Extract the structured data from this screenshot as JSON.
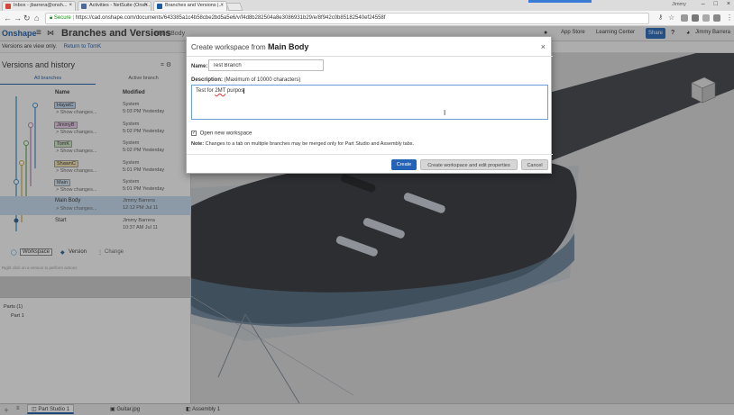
{
  "browser": {
    "tabs": [
      {
        "label": "Inbox - jbarrera@onsh...",
        "color": "#d44638"
      },
      {
        "label": "Activities - NetSuite (Onsh...",
        "color": "#4a6b9a"
      },
      {
        "label": "Branches and Versions |...",
        "color": "#1a5aa6"
      }
    ],
    "user": "Jimmy",
    "url_secure": "Secure",
    "url": "https://cad.onshape.com/documents/643385a1c4b58cbe2bd5a5e6/v/f4d8b282504a8e3086931b29/e/8f942c0b85182540ef24558f"
  },
  "header": {
    "logo": "Onshape",
    "doc_title": "Branches and Versions",
    "doc_sub": "Main Body",
    "app_store": "App Store",
    "learning_center": "Learning Center",
    "share": "Share",
    "help": "?",
    "user": "Jimmy Barrera"
  },
  "viewonly": {
    "text": "Versions are view only.",
    "link": "Return to TomK"
  },
  "panel": {
    "title": "Versions and history",
    "tabs": [
      "All branches",
      "Active branch"
    ],
    "col_name": "Name",
    "col_modified": "Modified",
    "rows": [
      {
        "name": "HayatC",
        "show": "> Show changes...",
        "by": "System",
        "when": "5:03 PM Yesterday",
        "tag": true,
        "tagcolor": "#bcd7ef"
      },
      {
        "name": "JimmyB",
        "show": "> Show changes...",
        "by": "System",
        "when": "5:02 PM Yesterday",
        "tag": true,
        "tagcolor": "#e6c9e6"
      },
      {
        "name": "TomK",
        "show": "> Show changes...",
        "by": "System",
        "when": "5:02 PM Yesterday",
        "tag": true,
        "tagcolor": "#c9e6c0"
      },
      {
        "name": "ShawnC",
        "show": "> Show changes...",
        "by": "System",
        "when": "5:01 PM Yesterday",
        "tag": true,
        "tagcolor": "#f0e0a8"
      },
      {
        "name": "Main",
        "show": "> Show changes...",
        "by": "System",
        "when": "5:01 PM Yesterday",
        "tag": true,
        "tagcolor": "#cfe3f2"
      },
      {
        "name": "Main Body",
        "show": "> Show changes...",
        "by": "Jimmy Barrera",
        "when": "12:12 PM Jul 11",
        "tag": false,
        "tagcolor": ""
      },
      {
        "name": "Start",
        "show": "",
        "by": "Jimmy Barrera",
        "when": "10:37 AM Jul 11",
        "tag": false,
        "tagcolor": ""
      }
    ],
    "legend_workspace": "Workspace",
    "legend_version": "Version",
    "legend_change": "Change",
    "rightclick": "Right click on a version to perform actions",
    "parts_header": "Parts (1)",
    "part_item": "Part 1"
  },
  "bottom_tabs": [
    "Part Studio 1",
    "Guitar.jpg",
    "Assembly 1"
  ],
  "dialog": {
    "title_prefix": "Create workspace from",
    "title_bold": "Main Body",
    "close": "×",
    "name_label": "Name:",
    "name_value": "Test Branch",
    "desc_label": "Description:",
    "desc_hint": "(Maximum of 10000 characters)",
    "desc_pre": "Test for ",
    "desc_spell": "2MT",
    "desc_post": " purpos",
    "open_workspace": "Open new workspace",
    "note_label": "Note:",
    "note_text": "Changes to a tab on multiple branches may be merged only for Part Studio and Assembly tabs.",
    "create": "Create",
    "create_edit": "Create workspace and edit properties",
    "cancel": "Cancel"
  }
}
